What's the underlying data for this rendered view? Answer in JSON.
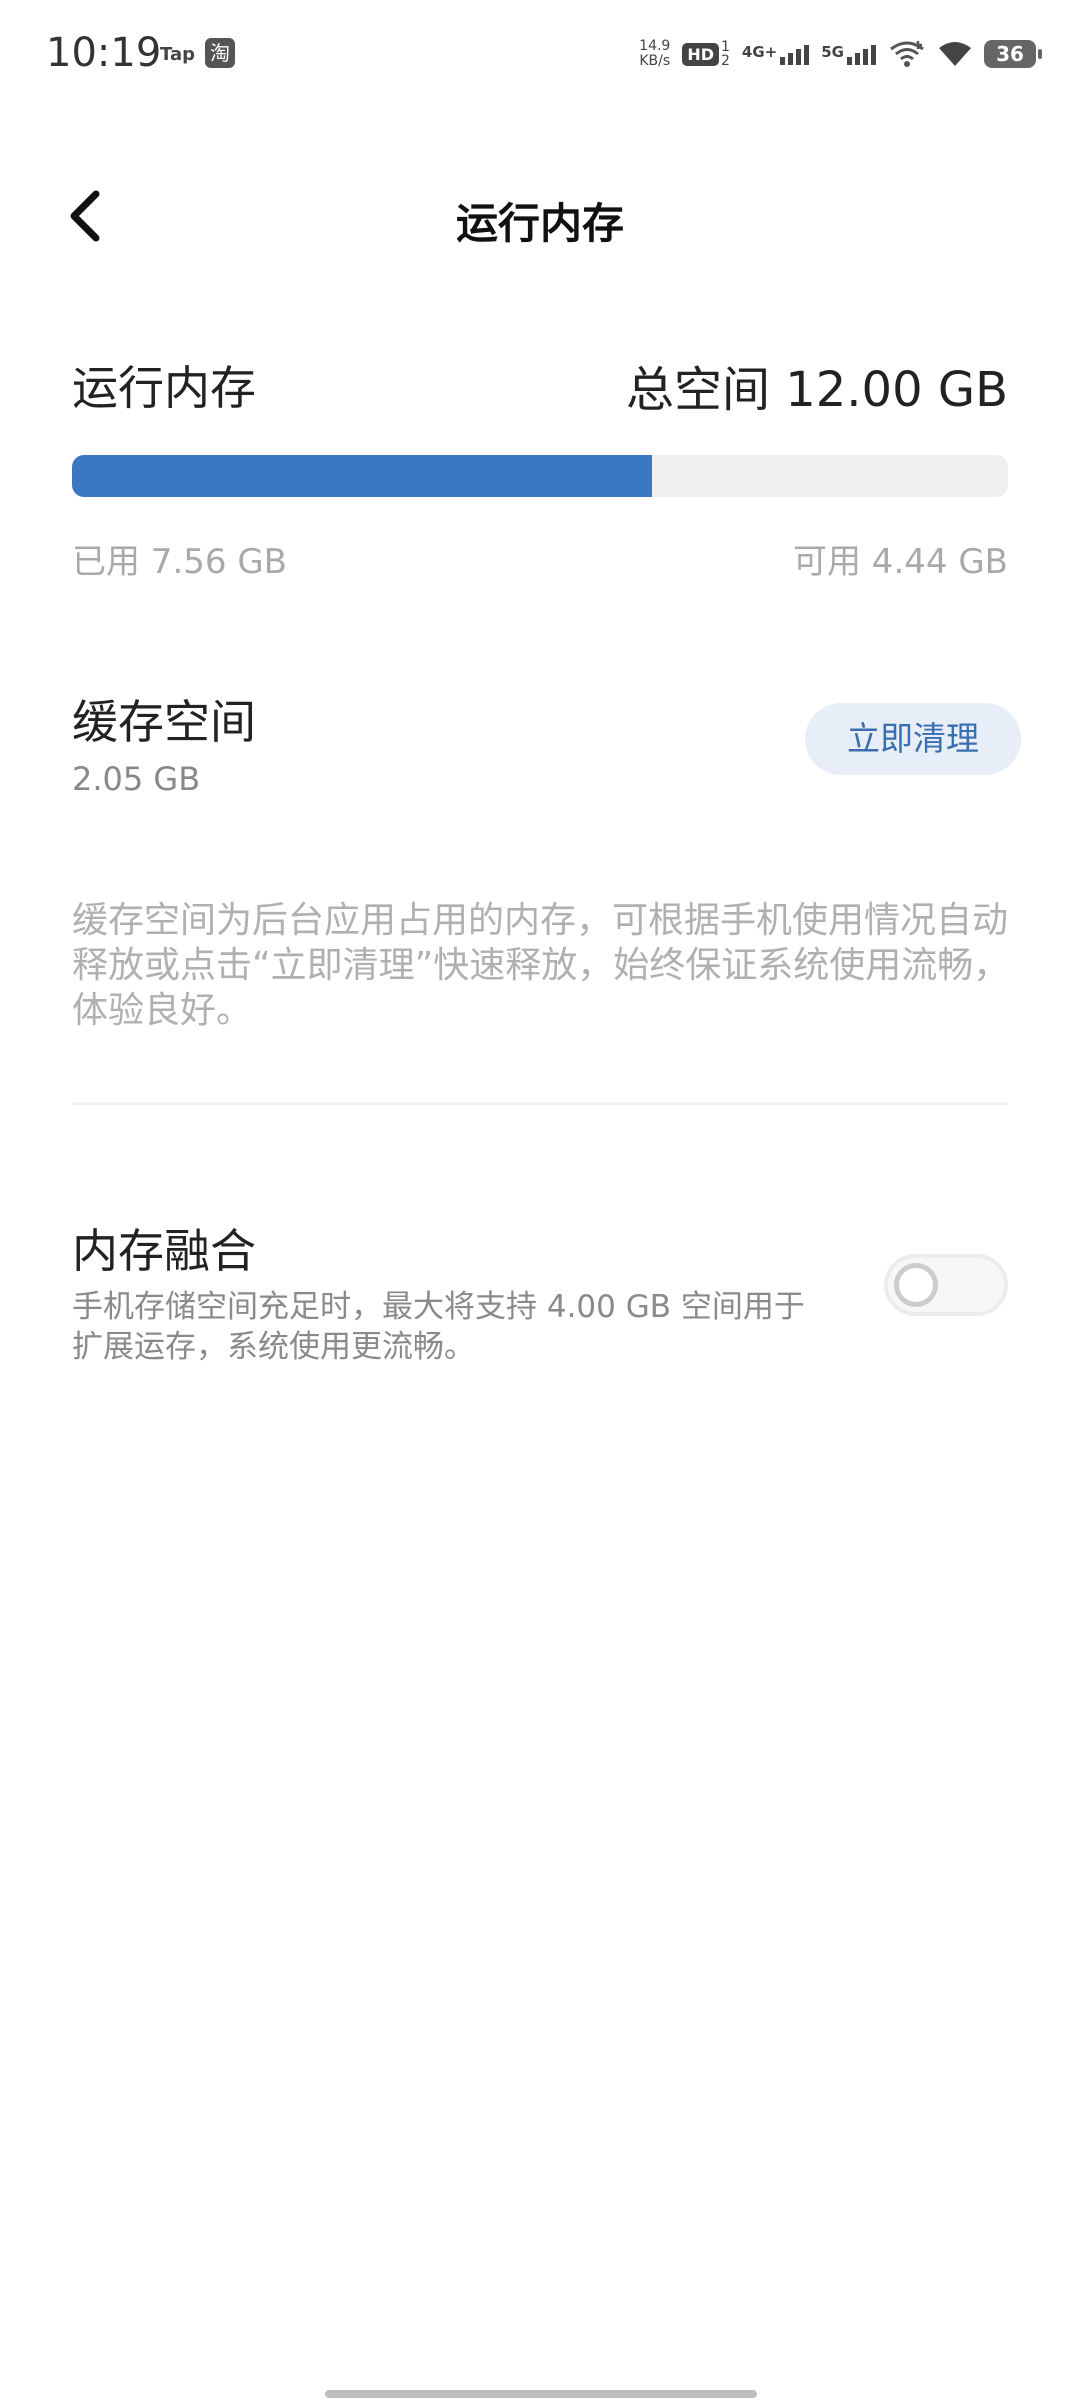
{
  "status_bar": {
    "time": "10:19",
    "tap": "Tap",
    "taobao": "淘",
    "speed_value": "14.9",
    "speed_unit": "KB/s",
    "hd": "HD",
    "hd_sub": "1\n2",
    "net1": "4G+",
    "net2": "5G",
    "battery": "36"
  },
  "header": {
    "title": "运行内存",
    "back_icon": "chevron-left-icon"
  },
  "memory": {
    "label": "运行内存",
    "total": "总空间 12.00 GB",
    "used": "已用 7.56 GB",
    "available": "可用 4.44 GB",
    "used_fraction": 0.62,
    "accent_color": "#3b78c3"
  },
  "cache": {
    "label": "缓存空间",
    "size": "2.05 GB",
    "clean_button": "立即清理",
    "description": "缓存空间为后台应用占用的内存，可根据手机使用情况自动释放或点击“立即清理”快速释放，始终保证系统使用流畅，体验良好。"
  },
  "fusion": {
    "label": "内存融合",
    "description": "手机存储空间充足时，最大将支持 4.00 GB 空间用于扩展运存，系统使用更流畅。",
    "enabled": false
  }
}
